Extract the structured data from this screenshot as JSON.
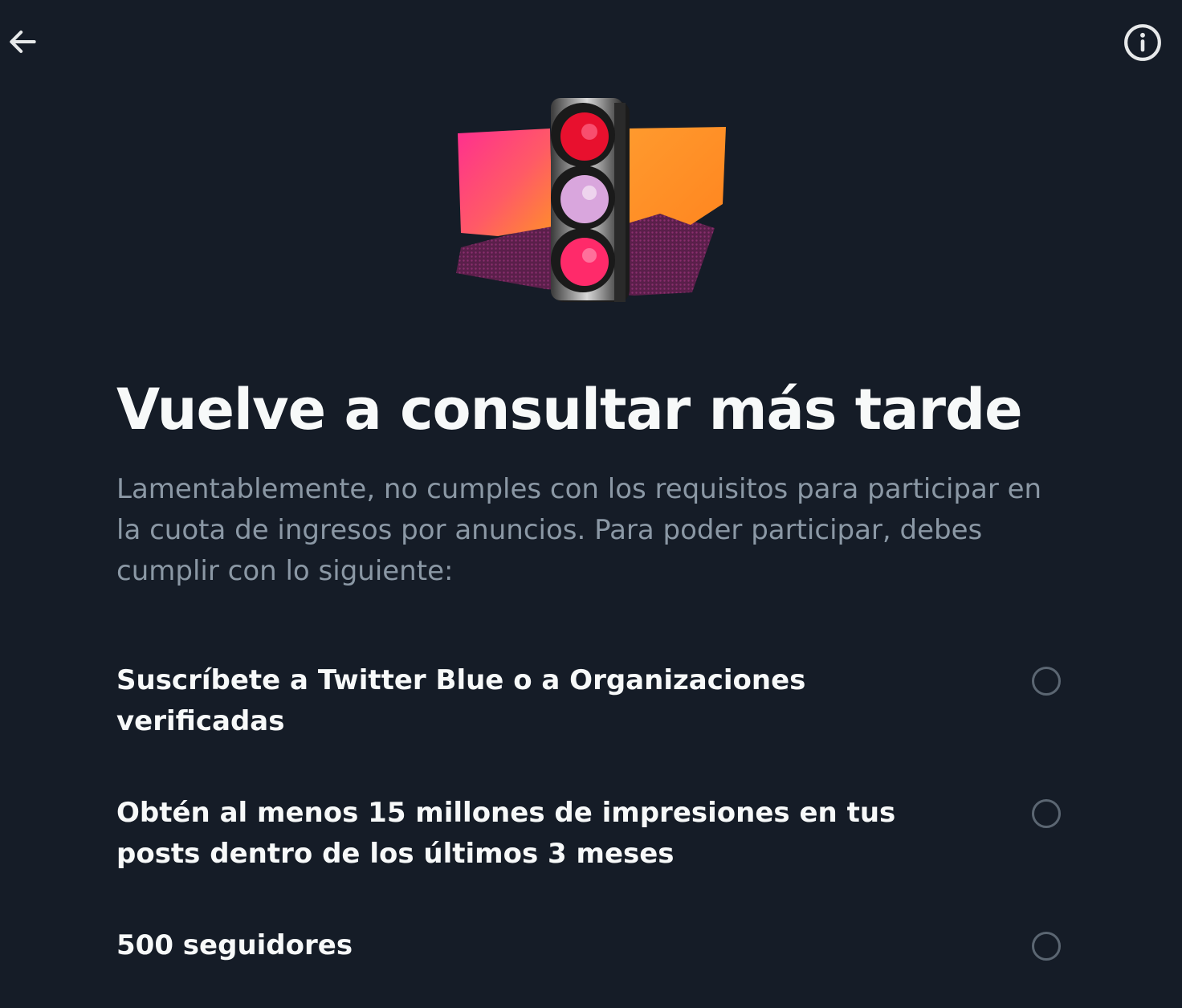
{
  "header": {
    "back_icon": "arrow-left-icon",
    "info_icon": "info-circle-icon"
  },
  "illustration": {
    "icon": "traffic-light-illustration",
    "colors": {
      "pink": "#ff3c8c",
      "orange": "#ff8a2a",
      "purple": "#6b2455",
      "red_light": "#e8102e",
      "lilac_light": "#d9a6dd",
      "magenta_light": "#ff2a6a"
    }
  },
  "main": {
    "title": "Vuelve a consultar más tarde",
    "description": "Lamentablemente, no cumples con los requisitos para participar en la cuota de ingresos por anuncios. Para poder participar, debes cumplir con lo siguiente:"
  },
  "requirements": [
    {
      "label": "Suscríbete a Twitter Blue o a Organizaciones verificadas",
      "checked": false
    },
    {
      "label": "Obtén al menos 15 millones de impresiones en tus posts dentro de los últimos 3 meses",
      "checked": false
    },
    {
      "label": "500 seguidores",
      "checked": false
    }
  ],
  "colors": {
    "background": "#151c27",
    "title_text": "#f7f9f9",
    "secondary_text": "#8b98a5",
    "checkbox_border": "#5b6672"
  }
}
